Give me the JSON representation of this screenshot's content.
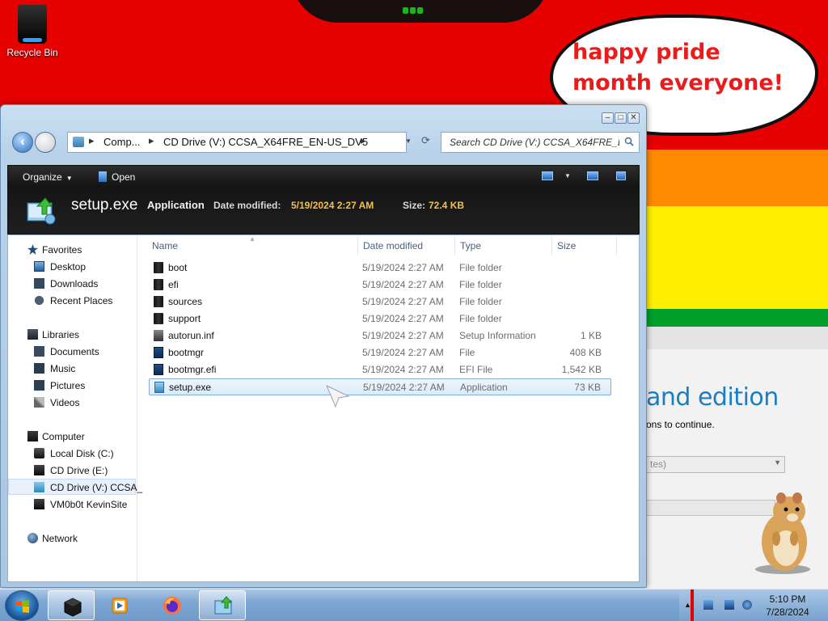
{
  "desktop": {
    "recycle_bin_label": "Recycle Bin",
    "bubble_text": "happy pride month everyone!",
    "setup_behind": {
      "title": "and edition",
      "subtitle": "ons to continue.",
      "select_text": "tes)"
    }
  },
  "explorer": {
    "address": {
      "crumb1": "Comp...",
      "crumb2": "CD Drive (V:) CCSA_X64FRE_EN-US_DV5"
    },
    "search_placeholder": "Search CD Drive (V:) CCSA_X64FRE_E...",
    "toolbar": {
      "organize": "Organize",
      "open": "Open"
    },
    "details": {
      "name": "setup.exe",
      "type": "Application",
      "date_label": "Date modified:",
      "date_value": "5/19/2024 2:27 AM",
      "size_label": "Size:",
      "size_value": "72.4 KB"
    },
    "nav": {
      "favorites": "Favorites",
      "desktop": "Desktop",
      "downloads": "Downloads",
      "recent": "Recent Places",
      "libraries": "Libraries",
      "documents": "Documents",
      "music": "Music",
      "pictures": "Pictures",
      "videos": "Videos",
      "computer": "Computer",
      "local_disk": "Local Disk (C:)",
      "cd_e": "CD Drive (E:)",
      "cd_v": "CD Drive (V:) CCSA_",
      "vm": "VM0b0t KevinSite",
      "network": "Network"
    },
    "columns": {
      "name": "Name",
      "date": "Date modified",
      "type": "Type",
      "size": "Size"
    },
    "files": [
      {
        "name": "boot",
        "date": "5/19/2024 2:27 AM",
        "type": "File folder",
        "size": ""
      },
      {
        "name": "efi",
        "date": "5/19/2024 2:27 AM",
        "type": "File folder",
        "size": ""
      },
      {
        "name": "sources",
        "date": "5/19/2024 2:27 AM",
        "type": "File folder",
        "size": ""
      },
      {
        "name": "support",
        "date": "5/19/2024 2:27 AM",
        "type": "File folder",
        "size": ""
      },
      {
        "name": "autorun.inf",
        "date": "5/19/2024 2:27 AM",
        "type": "Setup Information",
        "size": "1 KB"
      },
      {
        "name": "bootmgr",
        "date": "5/19/2024 2:27 AM",
        "type": "File",
        "size": "408 KB"
      },
      {
        "name": "bootmgr.efi",
        "date": "5/19/2024 2:27 AM",
        "type": "EFI File",
        "size": "1,542 KB"
      },
      {
        "name": "setup.exe",
        "date": "5/19/2024 2:27 AM",
        "type": "Application",
        "size": "73 KB"
      }
    ]
  },
  "taskbar": {
    "time": "5:10 PM",
    "date": "7/28/2024"
  },
  "colors": {
    "accent": "#2c6fbd",
    "details_value": "#f4c04a",
    "bubble_text": "#ea1b1b"
  }
}
